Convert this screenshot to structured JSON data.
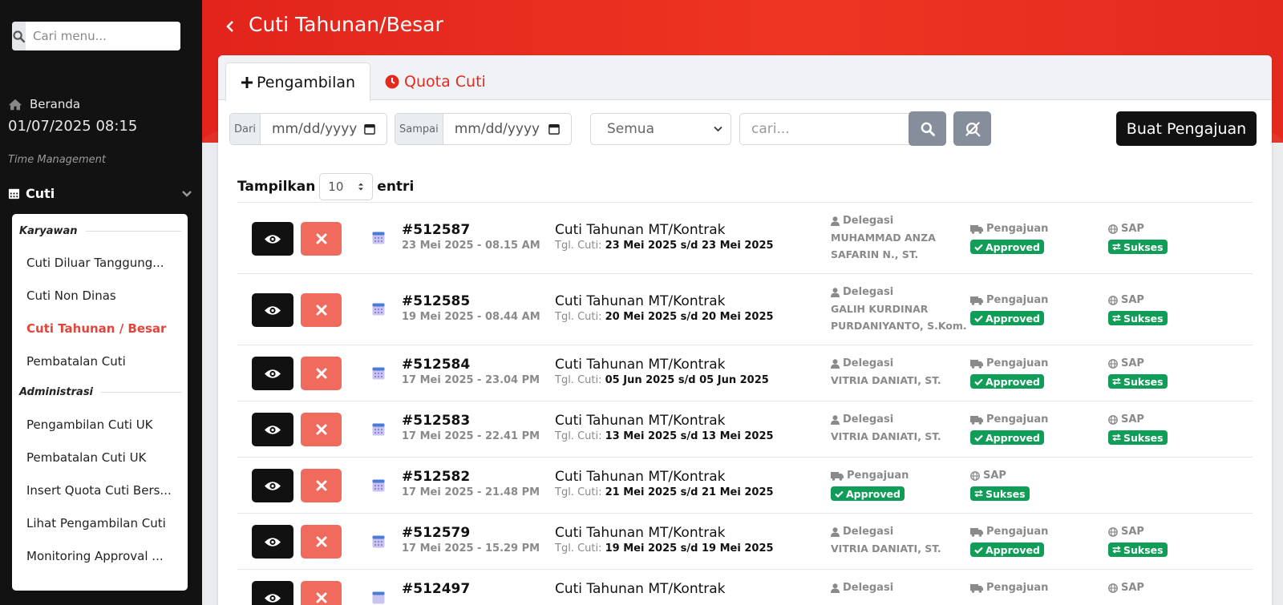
{
  "sidebar": {
    "search_placeholder": "Cari menu...",
    "home_label": "Beranda",
    "datetime": "01/07/2025 08:15",
    "section_label": "Time Management",
    "cuti_label": "Cuti",
    "group1_label": "Karyawan",
    "group2_label": "Administrasi",
    "items": [
      "Cuti Diluar Tanggung...",
      "Cuti Non Dinas",
      "Cuti Tahunan / Besar",
      "Pembatalan Cuti",
      "Pengambilan Cuti UK",
      "Pembatalan Cuti UK",
      "Insert Quota Cuti Bers...",
      "Lihat Pengambilan Cuti",
      "Monitoring Approval ..."
    ]
  },
  "header": {
    "title": "Cuti Tahunan/Besar"
  },
  "tabs": {
    "pengambilan": "Pengambilan",
    "quota": "Quota Cuti"
  },
  "filters": {
    "dari_label": "Dari",
    "dari_value": "mm/dd/yyyy",
    "sampai_label": "Sampai",
    "sampai_value": "mm/dd/yyyy",
    "status_value": "Semua",
    "search_placeholder": "cari...",
    "create_label": "Buat Pengajuan"
  },
  "length": {
    "prefix": "Tampilkan",
    "value": "10",
    "suffix": "entri"
  },
  "labels": {
    "tgl_prefix": "Tgl. Cuti:",
    "delegasi": "Delegasi",
    "pengajuan": "Pengajuan",
    "sap": "SAP"
  },
  "rows": [
    {
      "id": "#512587",
      "created": "23 Mei 2025 - 08.15 AM",
      "type": "Cuti Tahunan MT/Kontrak",
      "tgl": "23 Mei 2025 s/d 23 Mei 2025",
      "delegasi": [
        "MUHAMMAD ANZA",
        "SAFARIN N., ST."
      ],
      "status": "Approved",
      "sap": "Sukses"
    },
    {
      "id": "#512585",
      "created": "19 Mei 2025 - 08.44 AM",
      "type": "Cuti Tahunan MT/Kontrak",
      "tgl": "20 Mei 2025 s/d 20 Mei 2025",
      "delegasi": [
        "GALIH KURDINAR",
        "PURDANIYANTO, S.Kom."
      ],
      "status": "Approved",
      "sap": "Sukses"
    },
    {
      "id": "#512584",
      "created": "17 Mei 2025 - 23.04 PM",
      "type": "Cuti Tahunan MT/Kontrak",
      "tgl": "05 Jun 2025 s/d 05 Jun 2025",
      "delegasi": [
        "VITRIA DANIATI, ST."
      ],
      "status": "Approved",
      "sap": "Sukses"
    },
    {
      "id": "#512583",
      "created": "17 Mei 2025 - 22.41 PM",
      "type": "Cuti Tahunan MT/Kontrak",
      "tgl": "13 Mei 2025 s/d 13 Mei 2025",
      "delegasi": [
        "VITRIA DANIATI, ST."
      ],
      "status": "Approved",
      "sap": "Sukses"
    },
    {
      "id": "#512582",
      "created": "17 Mei 2025 - 21.48 PM",
      "type": "Cuti Tahunan MT/Kontrak",
      "tgl": "21 Mei 2025 s/d 21 Mei 2025",
      "delegasi": [],
      "status": "Approved",
      "sap": "Sukses"
    },
    {
      "id": "#512579",
      "created": "17 Mei 2025 - 15.29 PM",
      "type": "Cuti Tahunan MT/Kontrak",
      "tgl": "19 Mei 2025 s/d 19 Mei 2025",
      "delegasi": [
        "VITRIA DANIATI, ST."
      ],
      "status": "Approved",
      "sap": "Sukses"
    },
    {
      "id": "#512497",
      "created": "",
      "type": "Cuti Tahunan MT/Kontrak",
      "tgl": "",
      "delegasi": [],
      "status": "",
      "sap": ""
    }
  ],
  "colors": {
    "brand_red": "#e42a1f",
    "approved_green": "#0f9d58",
    "delete_btn": "#f06a5d"
  }
}
